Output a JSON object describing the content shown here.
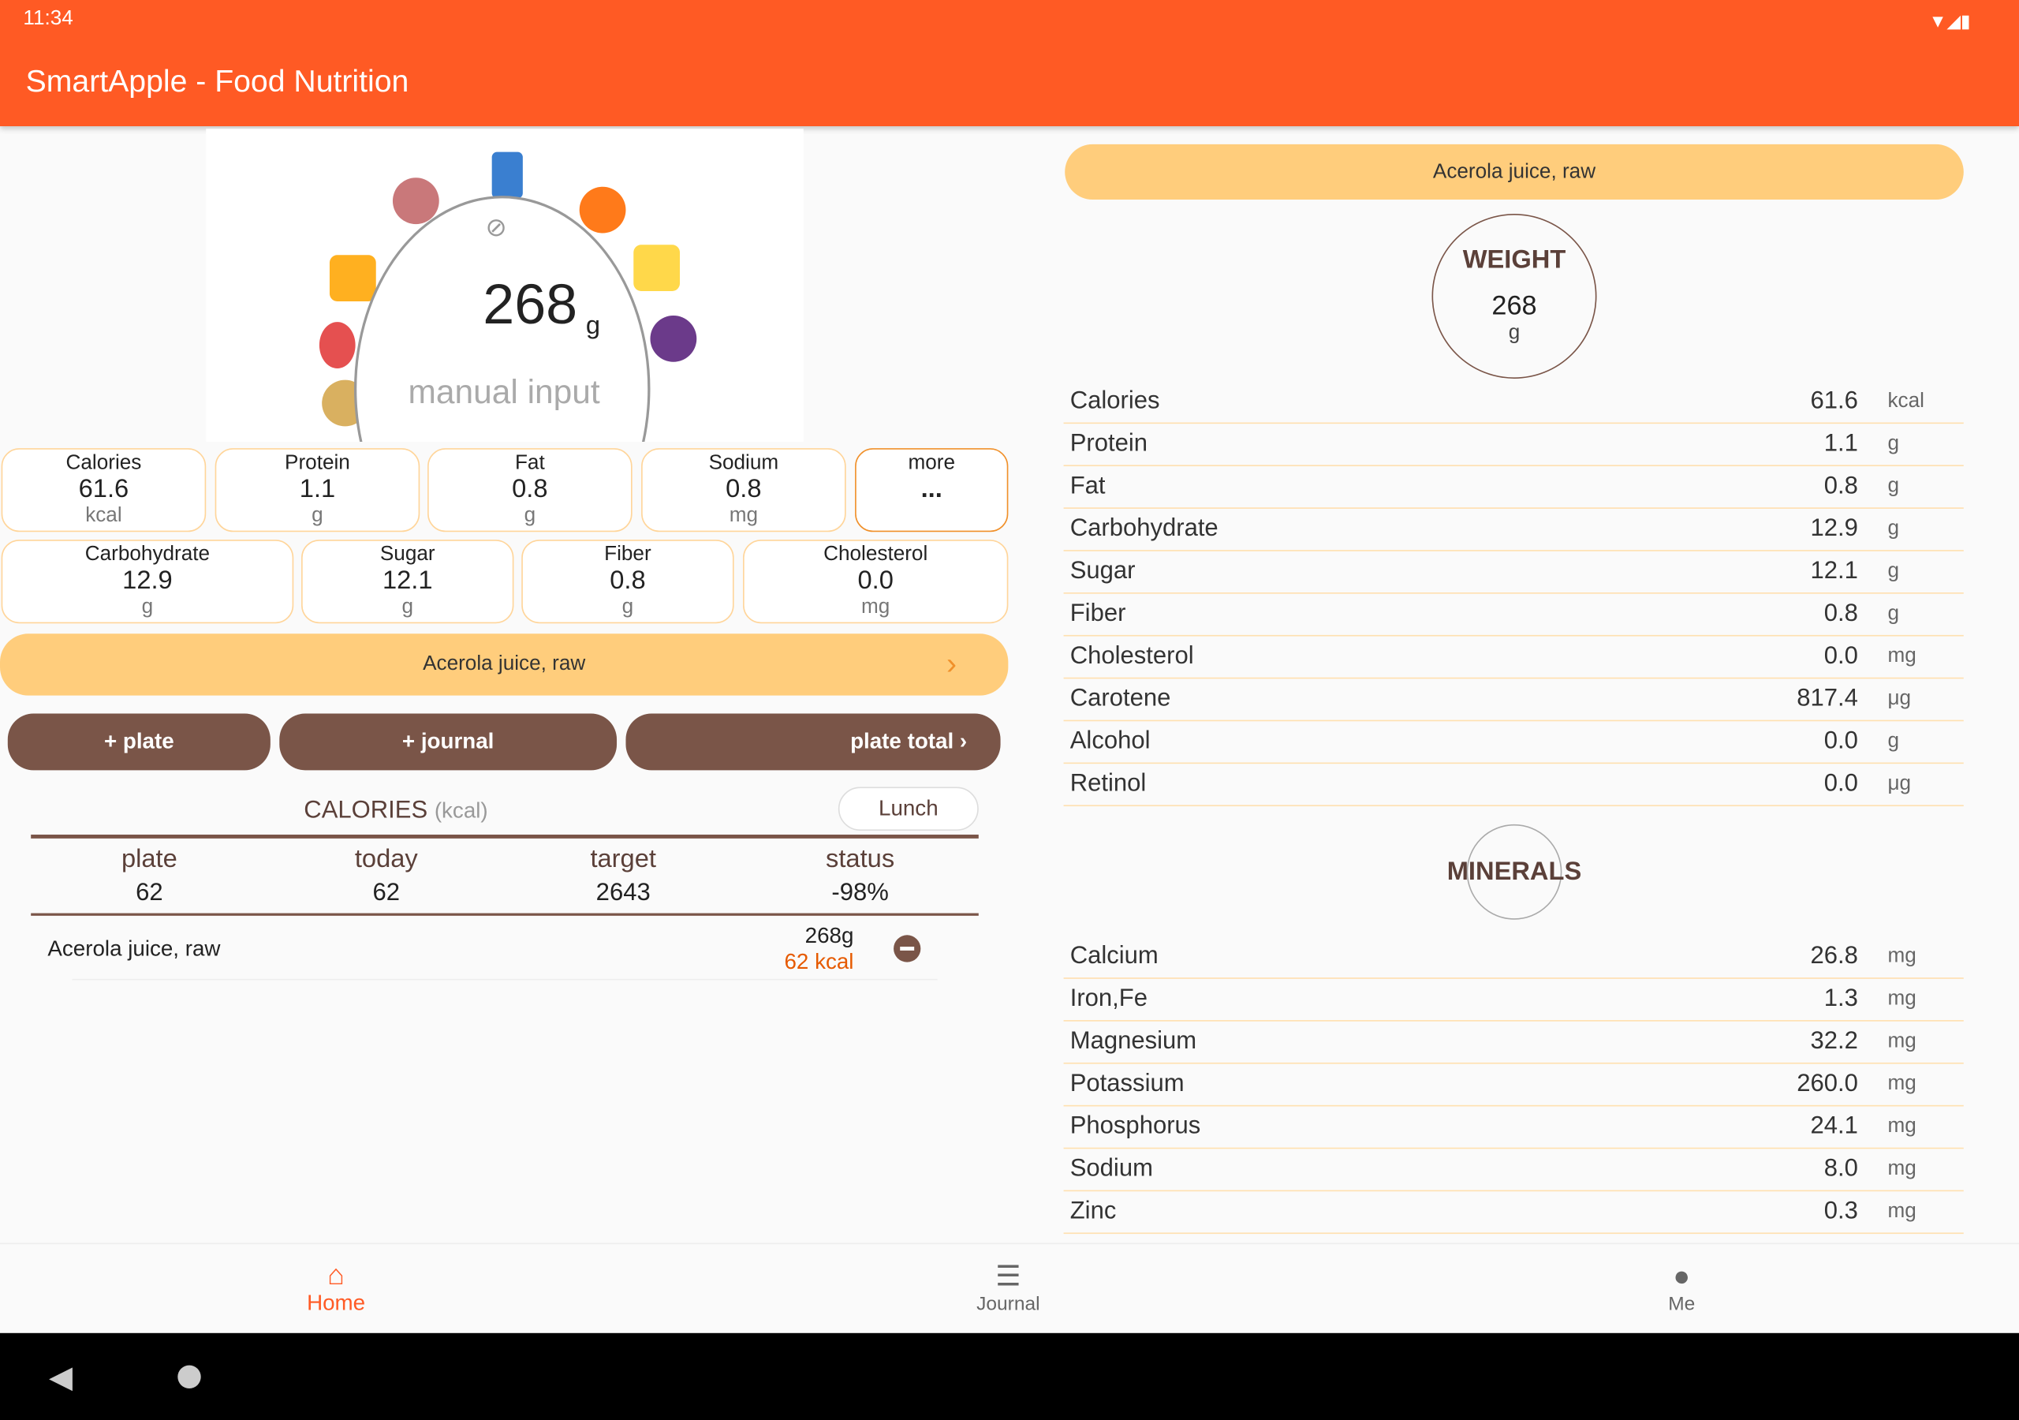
{
  "status_bar": {
    "time": "11:34"
  },
  "app": {
    "title": "SmartApple - Food Nutrition"
  },
  "scale": {
    "weight": "268",
    "unit": "g",
    "mode": "manual input",
    "icon": "link-off-icon"
  },
  "summary": [
    {
      "label": "Calories",
      "value": "61.6",
      "unit": "kcal"
    },
    {
      "label": "Protein",
      "value": "1.1",
      "unit": "g"
    },
    {
      "label": "Fat",
      "value": "0.8",
      "unit": "g"
    },
    {
      "label": "Sodium",
      "value": "0.8",
      "unit": "mg"
    },
    {
      "label": "more",
      "value": "..."
    },
    {
      "label": "Carbohydrate",
      "value": "12.9",
      "unit": "g"
    },
    {
      "label": "Sugar",
      "value": "12.1",
      "unit": "g"
    },
    {
      "label": "Fiber",
      "value": "0.8",
      "unit": "g"
    },
    {
      "label": "Cholesterol",
      "value": "0.0",
      "unit": "mg"
    }
  ],
  "food_selector": {
    "label": "Acerola juice, raw",
    "icon": "chevron-right-icon"
  },
  "actions": {
    "plate": "+ plate",
    "journal": "+ journal",
    "plate_total": "plate total ›"
  },
  "calories": {
    "title": "CALORIES",
    "unit": "(kcal)",
    "meal": "Lunch",
    "headers": [
      "plate",
      "today",
      "target",
      "status"
    ],
    "values": [
      "62",
      "62",
      "2643",
      "-98%"
    ]
  },
  "plate_items": [
    {
      "name": "Acerola juice, raw",
      "weight": "268g",
      "kcal": "62 kcal"
    }
  ],
  "detail": {
    "food": "Acerola juice, raw",
    "weight_title": "WEIGHT",
    "weight": "268",
    "weight_unit": "g",
    "nutrients": [
      {
        "name": "Calories",
        "value": "61.6",
        "unit": "kcal"
      },
      {
        "name": "Protein",
        "value": "1.1",
        "unit": "g"
      },
      {
        "name": "Fat",
        "value": "0.8",
        "unit": "g"
      },
      {
        "name": "Carbohydrate",
        "value": "12.9",
        "unit": "g"
      },
      {
        "name": "Sugar",
        "value": "12.1",
        "unit": "g"
      },
      {
        "name": "Fiber",
        "value": "0.8",
        "unit": "g"
      },
      {
        "name": "Cholesterol",
        "value": "0.0",
        "unit": "mg"
      },
      {
        "name": "Carotene",
        "value": "817.4",
        "unit": "μg"
      },
      {
        "name": "Alcohol",
        "value": "0.0",
        "unit": "g"
      },
      {
        "name": "Retinol",
        "value": "0.0",
        "unit": "μg"
      }
    ],
    "minerals_title": "MINERALS",
    "minerals": [
      {
        "name": "Calcium",
        "value": "26.8",
        "unit": "mg"
      },
      {
        "name": "Iron,Fe",
        "value": "1.3",
        "unit": "mg"
      },
      {
        "name": "Magnesium",
        "value": "32.2",
        "unit": "mg"
      },
      {
        "name": "Potassium",
        "value": "260.0",
        "unit": "mg"
      },
      {
        "name": "Phosphorus",
        "value": "24.1",
        "unit": "mg"
      },
      {
        "name": "Sodium",
        "value": "8.0",
        "unit": "mg"
      },
      {
        "name": "Zinc",
        "value": "0.3",
        "unit": "mg"
      }
    ]
  },
  "nav": [
    {
      "label": "Home",
      "icon": "home-icon",
      "active": true
    },
    {
      "label": "Journal",
      "icon": "list-icon"
    },
    {
      "label": "Me",
      "icon": "person-icon"
    }
  ],
  "colors": {
    "primary": "#ff5a24",
    "brown": "#7a5548",
    "accent": "#ffcd7c"
  }
}
